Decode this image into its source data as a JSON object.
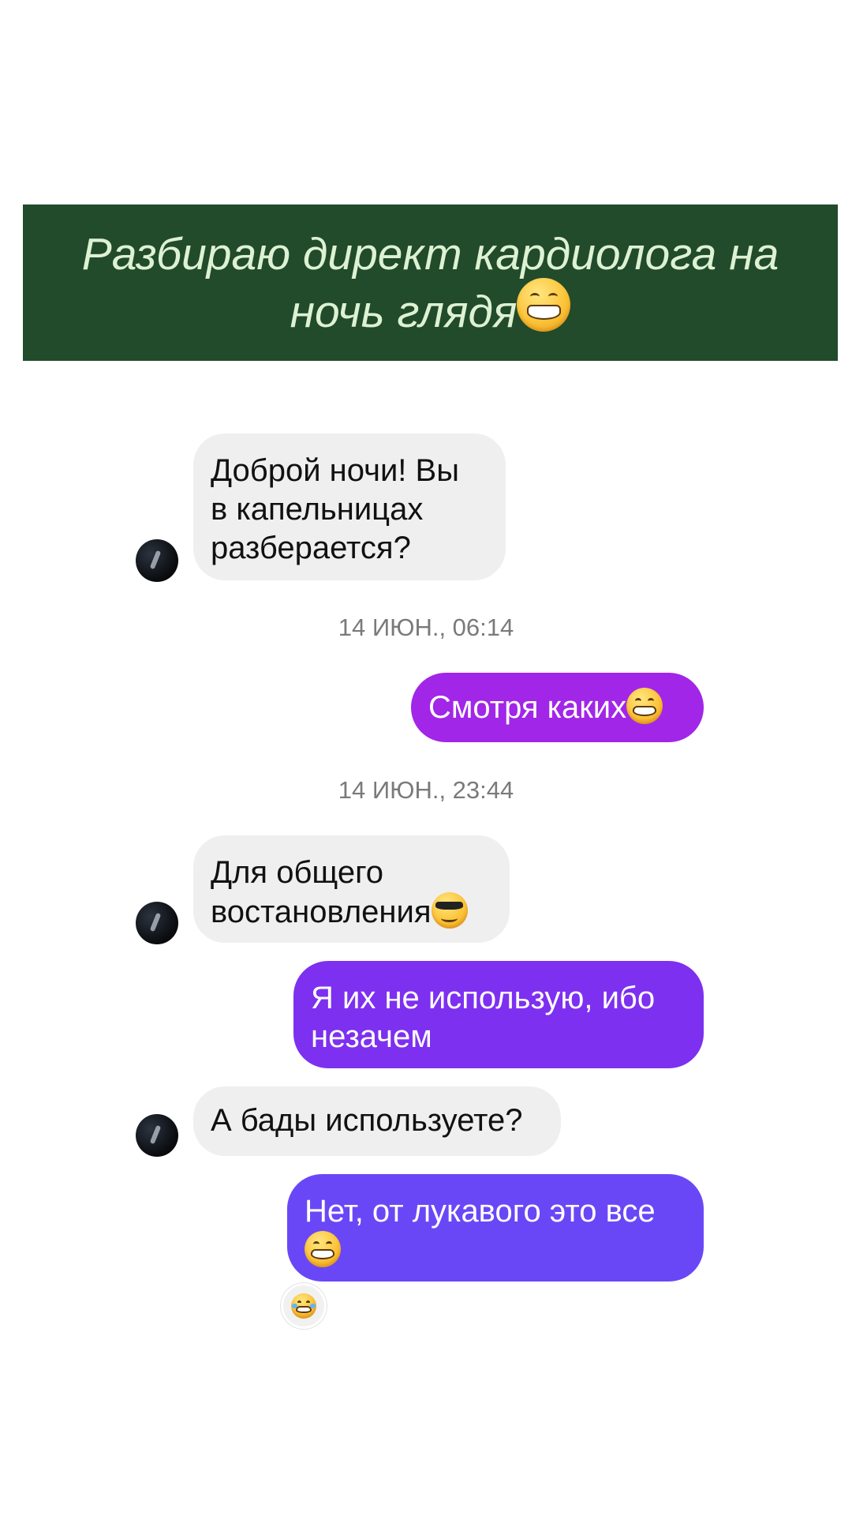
{
  "banner": {
    "title": "Разбираю директ кардиолога на ночь глядя",
    "emoji": "grinning-face-icon"
  },
  "messages": [
    {
      "from": "other",
      "text": "Доброй ночи! Вы\nв капельницах\nразберается?"
    },
    {
      "type": "timestamp",
      "text": "14 ИЮН., 06:14"
    },
    {
      "from": "me",
      "text": "Смотря каких",
      "emoji": "grinning-face-icon",
      "color": "#a126e8"
    },
    {
      "type": "timestamp",
      "text": "14 ИЮН., 23:44"
    },
    {
      "from": "other",
      "text": "Для общего\nвостановления",
      "emoji": "sunglasses-face-icon"
    },
    {
      "from": "me",
      "text": "Я их не использую, ибо\nнезачем",
      "color": "#7d30f0"
    },
    {
      "from": "other",
      "text": "А бады используете?"
    },
    {
      "from": "me",
      "text": "Нет, от лукавого это все",
      "emoji": "grinning-face-icon",
      "color": "#6a47f6",
      "reaction": "tears-of-joy-icon"
    }
  ],
  "colors": {
    "banner_bg": "#214b2b",
    "banner_text": "#ddf2d3",
    "incoming_bubble": "#efefef",
    "outgoing_purple_1": "#a126e8",
    "outgoing_purple_2": "#7d30f0",
    "outgoing_purple_3": "#6a47f6"
  }
}
